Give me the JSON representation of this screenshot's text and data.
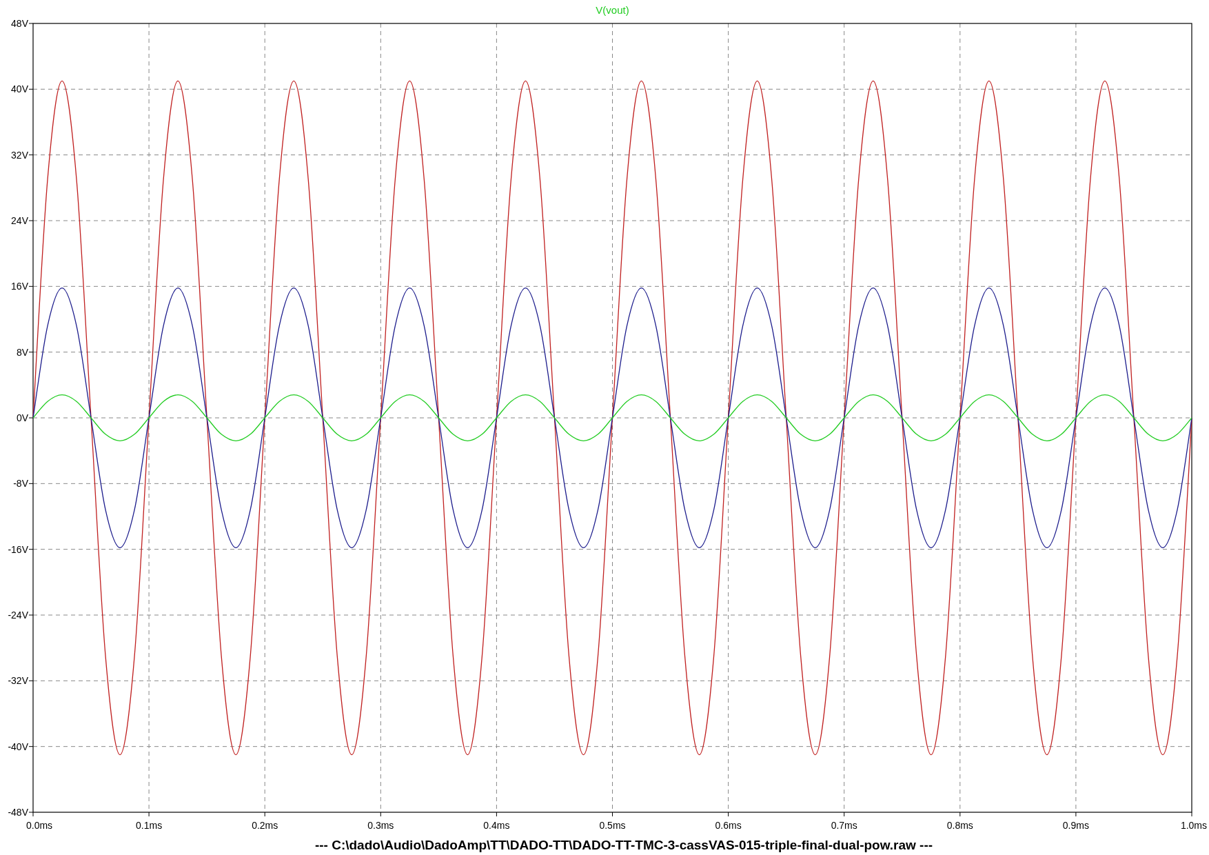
{
  "plot": {
    "chart_data": {
      "type": "line",
      "grid": true,
      "xlabel": "---  C:\\dado\\Audio\\DadoAmp\\TT\\DADO-TT\\DADO-TT-TMC-3-cassVAS-015-triple-final-dual-pow.raw  ---",
      "x": [
        0,
        0.0125,
        0.025,
        0.0375,
        0.05,
        0.0625,
        0.075,
        0.0875,
        0.1,
        0.1125,
        0.125,
        0.1375,
        0.15,
        0.1625,
        0.175,
        0.1875,
        0.2,
        0.2125,
        0.225,
        0.2375,
        0.25,
        0.2625,
        0.275,
        0.2875,
        0.3,
        0.3125,
        0.325,
        0.3375,
        0.35,
        0.3625,
        0.375,
        0.3875,
        0.4,
        0.4125,
        0.425,
        0.4375,
        0.45,
        0.4625,
        0.475,
        0.4875,
        0.5,
        0.5125,
        0.525,
        0.5375,
        0.55,
        0.5625,
        0.575,
        0.5875,
        0.6,
        0.6125,
        0.625,
        0.6375,
        0.65,
        0.6625,
        0.675,
        0.6875,
        0.7,
        0.7125,
        0.725,
        0.7375,
        0.75,
        0.7625,
        0.775,
        0.7875,
        0.8,
        0.8125,
        0.825,
        0.8375,
        0.85,
        0.8625,
        0.875,
        0.8875,
        0.9,
        0.9125,
        0.925,
        0.9375,
        0.95,
        0.9625,
        0.975,
        0.9875,
        1.0
      ],
      "series": [
        {
          "color": "#c02020",
          "values": [
            0,
            29,
            41,
            29,
            0,
            -29,
            -41,
            -29,
            0,
            29,
            41,
            29,
            0,
            -29,
            -41,
            -29,
            0,
            29,
            41,
            29,
            0,
            -29,
            -41,
            -29,
            0,
            29,
            41,
            29,
            0,
            -29,
            -41,
            -29,
            0,
            29,
            41,
            29,
            0,
            -29,
            -41,
            -29,
            0,
            29,
            41,
            29,
            0,
            -29,
            -41,
            -29,
            0,
            29,
            41,
            29,
            0,
            -29,
            -41,
            -29,
            0,
            29,
            41,
            29,
            0,
            -29,
            -41,
            -29,
            0,
            29,
            41,
            29,
            0,
            -29,
            -41,
            -29,
            0,
            29,
            41,
            29,
            0,
            -29,
            -41,
            -29,
            0
          ]
        },
        {
          "color": "#1c1c8c",
          "values": [
            0,
            11.2,
            15.8,
            11.2,
            0,
            -11.2,
            -15.8,
            -11.2,
            0,
            11.2,
            15.8,
            11.2,
            0,
            -11.2,
            -15.8,
            -11.2,
            0,
            11.2,
            15.8,
            11.2,
            0,
            -11.2,
            -15.8,
            -11.2,
            0,
            11.2,
            15.8,
            11.2,
            0,
            -11.2,
            -15.8,
            -11.2,
            0,
            11.2,
            15.8,
            11.2,
            0,
            -11.2,
            -15.8,
            -11.2,
            0,
            11.2,
            15.8,
            11.2,
            0,
            -11.2,
            -15.8,
            -11.2,
            0,
            11.2,
            15.8,
            11.2,
            0,
            -11.2,
            -15.8,
            -11.2,
            0,
            11.2,
            15.8,
            11.2,
            0,
            -11.2,
            -15.8,
            -11.2,
            0,
            11.2,
            15.8,
            11.2,
            0,
            -11.2,
            -15.8,
            -11.2,
            0,
            11.2,
            15.8,
            11.2,
            0,
            -11.2,
            -15.8,
            -11.2,
            0
          ]
        },
        {
          "name": "V(vout)",
          "color": "#22cc22",
          "values": [
            0,
            2,
            2.8,
            2,
            0,
            -2,
            -2.8,
            -2,
            0,
            2,
            2.8,
            2,
            0,
            -2,
            -2.8,
            -2,
            0,
            2,
            2.8,
            2,
            0,
            -2,
            -2.8,
            -2,
            0,
            2,
            2.8,
            2,
            0,
            -2,
            -2.8,
            -2,
            0,
            2,
            2.8,
            2,
            0,
            -2,
            -2.8,
            -2,
            0,
            2,
            2.8,
            2,
            0,
            -2,
            -2.8,
            -2,
            0,
            2,
            2.8,
            2,
            0,
            -2,
            -2.8,
            -2,
            0,
            2,
            2.8,
            2,
            0,
            -2,
            -2.8,
            -2,
            0,
            2,
            2.8,
            2,
            0,
            -2,
            -2.8,
            -2,
            0,
            2,
            2.8,
            2,
            0,
            -2,
            -2.8,
            -2,
            0
          ]
        }
      ],
      "xlim": [
        0,
        1
      ],
      "ylim": [
        -48,
        48
      ],
      "xticks": [
        {
          "value": 0,
          "label": "0.0ms"
        },
        {
          "value": 0.1,
          "label": "0.1ms"
        },
        {
          "value": 0.2,
          "label": "0.2ms"
        },
        {
          "value": 0.3,
          "label": "0.3ms"
        },
        {
          "value": 0.4,
          "label": "0.4ms"
        },
        {
          "value": 0.5,
          "label": "0.5ms"
        },
        {
          "value": 0.6,
          "label": "0.6ms"
        },
        {
          "value": 0.7,
          "label": "0.7ms"
        },
        {
          "value": 0.8,
          "label": "0.8ms"
        },
        {
          "value": 0.9,
          "label": "0.9ms"
        },
        {
          "value": 1,
          "label": "1.0ms"
        }
      ],
      "yticks": [
        {
          "value": 48,
          "label": "48V"
        },
        {
          "value": 40,
          "label": "40V"
        },
        {
          "value": 32,
          "label": "32V"
        },
        {
          "value": 24,
          "label": "24V"
        },
        {
          "value": 16,
          "label": "16V"
        },
        {
          "value": 8,
          "label": "8V"
        },
        {
          "value": 0,
          "label": "0V"
        },
        {
          "value": -8,
          "label": "-8V"
        },
        {
          "value": -16,
          "label": "-16V"
        },
        {
          "value": -24,
          "label": "-24V"
        },
        {
          "value": -32,
          "label": "-32V"
        },
        {
          "value": -40,
          "label": "-40V"
        },
        {
          "value": -48,
          "label": "-48V"
        }
      ]
    }
  }
}
